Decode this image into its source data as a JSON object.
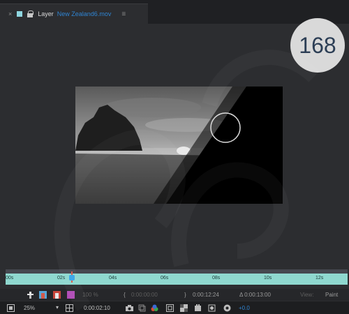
{
  "tab": {
    "close_glyph": "×",
    "title": "Layer",
    "filename": "New Zealand6.mov",
    "menu_glyph": "≡"
  },
  "page_number": "168",
  "timeline": {
    "ticks": [
      "00s",
      "02s",
      "04s",
      "06s",
      "08s",
      "10s",
      "12s"
    ]
  },
  "controls": {
    "opacity": "100 %",
    "in_point": "0:00:00:00",
    "out_point": "0:00:12:24",
    "duration": "Δ 0:00:13:00",
    "view_label": "View:",
    "view_value": "Paint",
    "zoom": "25%",
    "current_time": "0:00:02:10",
    "exposure": "+0.0",
    "in_bracket": "{",
    "out_bracket": "}"
  },
  "colors": {
    "accent_blue": "#2f84d2",
    "ruler": "#8fd8cf",
    "playhead": "#3aa6e8"
  }
}
